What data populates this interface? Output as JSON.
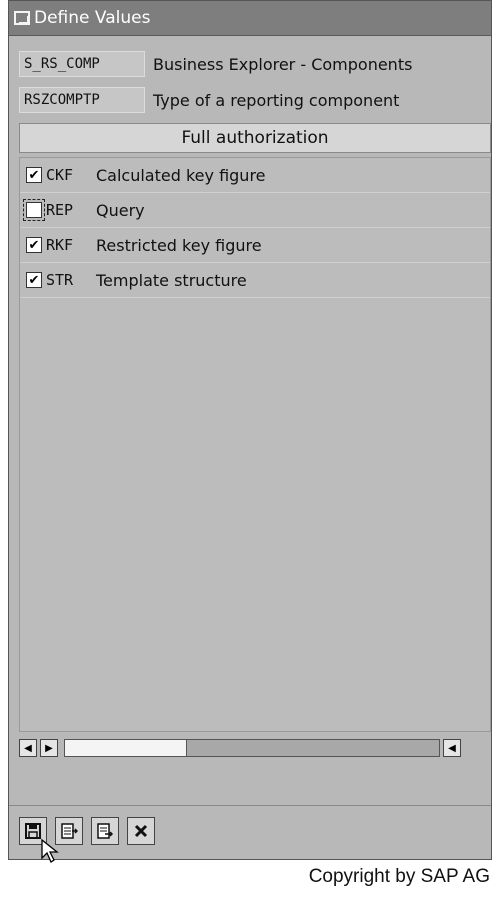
{
  "window": {
    "title": "Define Values"
  },
  "fields": [
    {
      "code": "S_RS_COMP",
      "description": "Business Explorer - Components"
    },
    {
      "code": "RSZCOMPTP",
      "description": "Type of a reporting component"
    }
  ],
  "full_authorization_label": "Full authorization",
  "rows": [
    {
      "checked": true,
      "code": "CKF",
      "description": "Calculated key figure"
    },
    {
      "checked": false,
      "code": "REP",
      "description": "Query"
    },
    {
      "checked": true,
      "code": "RKF",
      "description": "Restricted key figure"
    },
    {
      "checked": true,
      "code": "STR",
      "description": "Template structure"
    }
  ],
  "scroll": {
    "left_icon": "arrow-left-icon",
    "right_icon": "arrow-right-icon"
  },
  "toolbar": [
    {
      "icon": "save-icon"
    },
    {
      "icon": "document-export-icon"
    },
    {
      "icon": "document-arrow-icon"
    },
    {
      "icon": "cancel-icon"
    }
  ],
  "copyright": "Copyright by SAP AG"
}
